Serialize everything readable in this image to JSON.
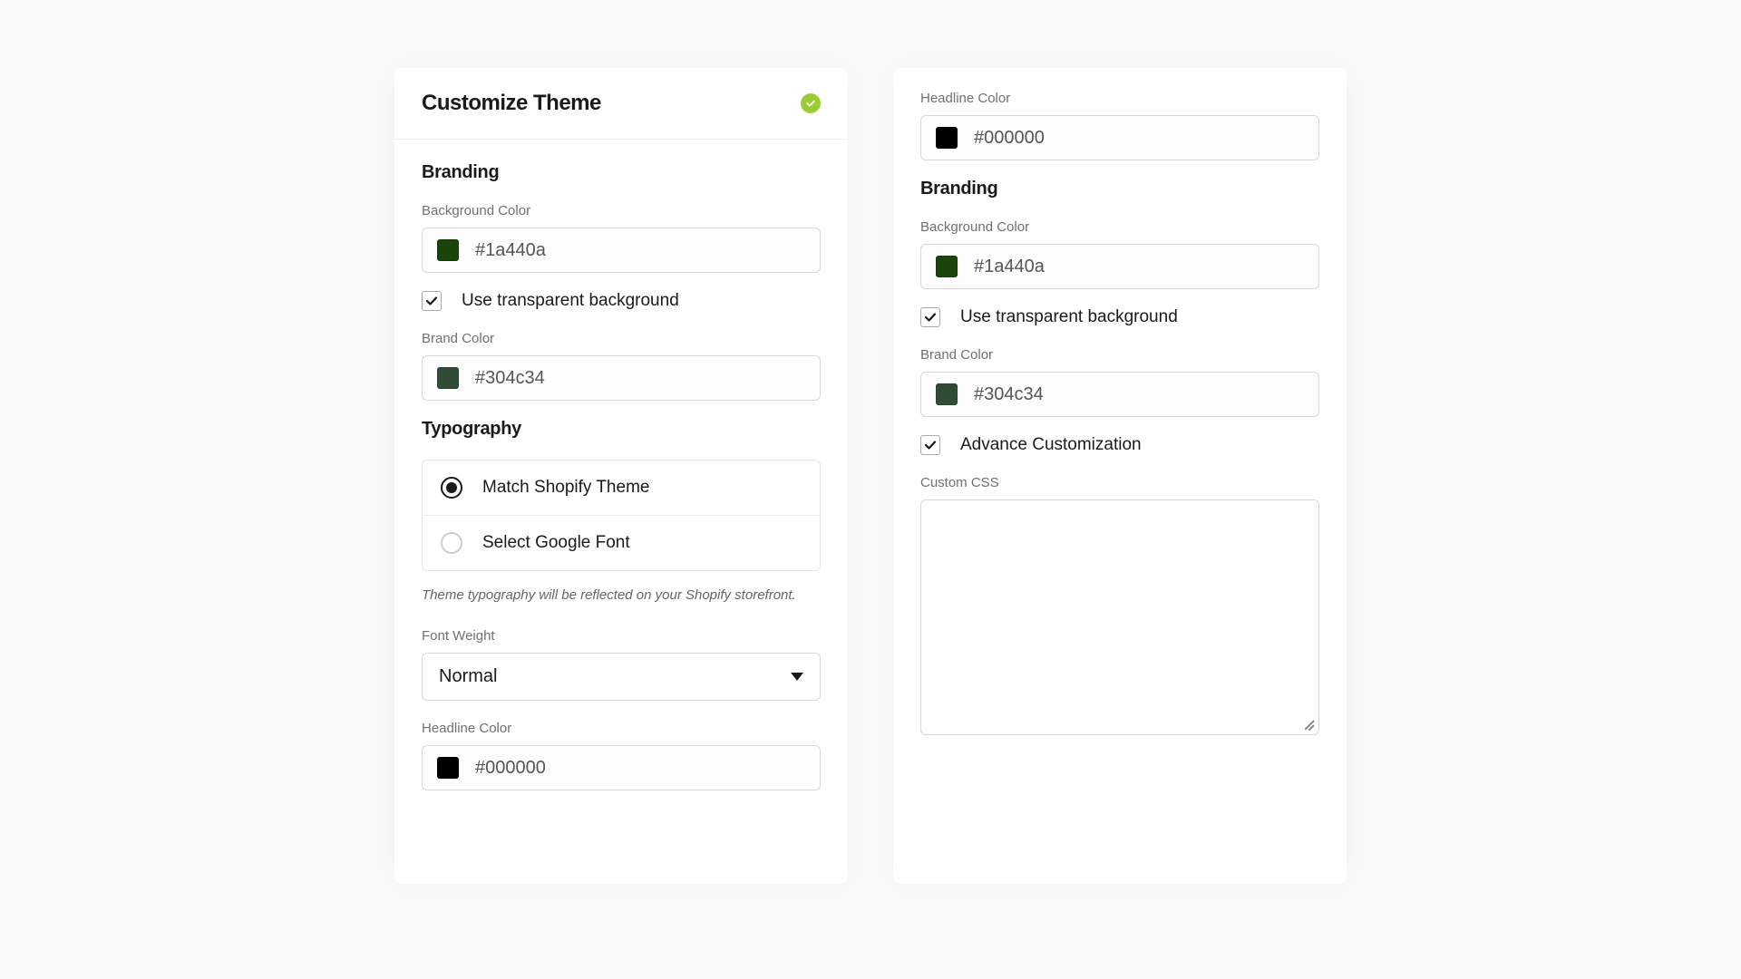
{
  "leftPanel": {
    "title": "Customize Theme",
    "branding": {
      "title": "Branding",
      "bgLabel": "Background Color",
      "bgValue": "#1a440a",
      "bgSwatch": "#1a440a",
      "transparentLabel": "Use transparent background",
      "brandLabel": "Brand Color",
      "brandValue": "#304c34",
      "brandSwatch": "#304c34"
    },
    "typography": {
      "title": "Typography",
      "option1": "Match Shopify Theme",
      "option2": "Select Google Font",
      "hint": "Theme typography will be reflected on your Shopify storefront.",
      "fontWeightLabel": "Font Weight",
      "fontWeightValue": "Normal",
      "headlineLabel": "Headline Color",
      "headlineValue": "#000000",
      "headlineSwatch": "#000000"
    }
  },
  "rightPanel": {
    "headlineLabel": "Headline Color",
    "headlineValue": "#000000",
    "headlineSwatch": "#000000",
    "branding": {
      "title": "Branding",
      "bgLabel": "Background Color",
      "bgValue": "#1a440a",
      "bgSwatch": "#1a440a",
      "transparentLabel": "Use transparent background",
      "brandLabel": "Brand Color",
      "brandValue": "#304c34",
      "brandSwatch": "#304c34"
    },
    "advCustomLabel": "Advance Customization",
    "customCssLabel": "Custom CSS"
  }
}
